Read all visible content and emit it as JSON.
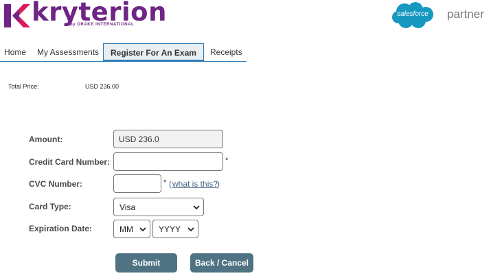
{
  "brand": {
    "logo_text": "kryterion",
    "logo_subtext": "by DRAKE INTERNATIONAL",
    "partner_logo_text": "salesforce",
    "partner_label": "partner"
  },
  "colors": {
    "brand_purple": "#6e2585",
    "brand_pink": "#e0195a",
    "tab_accent": "#2b7bb9",
    "button_bg": "#4f7383",
    "salesforce_blue": "#1798c1"
  },
  "tabs": [
    {
      "label": "Home",
      "active": false
    },
    {
      "label": "My Assessments",
      "active": false
    },
    {
      "label": "Register For An Exam",
      "active": true
    },
    {
      "label": "Receipts",
      "active": false
    }
  ],
  "summary": {
    "total_label": "Total Price:",
    "total_value": "USD 236.00"
  },
  "form": {
    "amount": {
      "label": "Amount:",
      "value": "USD 236.0"
    },
    "credit_card": {
      "label": "Credit Card Number:",
      "value": "",
      "required_mark": "*"
    },
    "cvc": {
      "label": "CVC Number:",
      "value": "",
      "required_mark": "*",
      "help_prefix": "(",
      "help_link": "what is this?",
      "help_suffix": ")"
    },
    "card_type": {
      "label": "Card Type:",
      "selected": "Visa"
    },
    "expiration": {
      "label": "Expiration Date:",
      "month_selected": "MM",
      "year_selected": "YYYY"
    }
  },
  "buttons": {
    "submit": "Submit",
    "back_cancel": "Back / Cancel"
  }
}
